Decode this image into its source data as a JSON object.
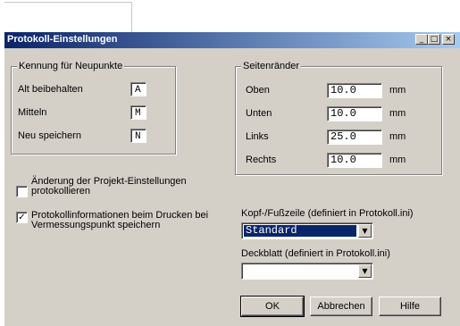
{
  "window": {
    "title": "Protokoll-Einstellungen",
    "min_glyph": "_",
    "max_glyph": "□",
    "close_glyph": "×"
  },
  "kennung": {
    "legend": "Kennung für Neupunkte",
    "rows": [
      {
        "label": "Alt beibehalten",
        "value": "A"
      },
      {
        "label": "Mitteln",
        "value": "M"
      },
      {
        "label": "Neu speichern",
        "value": "N"
      }
    ]
  },
  "seiten": {
    "legend": "Seitenränder",
    "rows": [
      {
        "label": "Oben",
        "value": "10.0",
        "unit": "mm"
      },
      {
        "label": "Unten",
        "value": "10.0",
        "unit": "mm"
      },
      {
        "label": "Links",
        "value": "25.0",
        "unit": "mm"
      },
      {
        "label": "Rechts",
        "value": "10.0",
        "unit": "mm"
      }
    ]
  },
  "checkboxes": [
    {
      "label_line1": "Änderung der Projekt-Einstellungen",
      "label_line2": "protokollieren",
      "checked": false,
      "mark": ""
    },
    {
      "label_line1": "Protokollinformationen beim Drucken bei",
      "label_line2": "Vermessungspunkt speichern",
      "checked": true,
      "mark": "✓"
    }
  ],
  "kopf": {
    "label": "Kopf-/Fußzeile (definiert in Protokoll.ini)",
    "value": "Standard"
  },
  "deck": {
    "label": "Deckblatt (definiert in Protokoll.ini)",
    "value": ""
  },
  "combo_arrow": "▼",
  "buttons": {
    "ok": "OK",
    "cancel": "Abbrechen",
    "help": "Hilfe"
  }
}
